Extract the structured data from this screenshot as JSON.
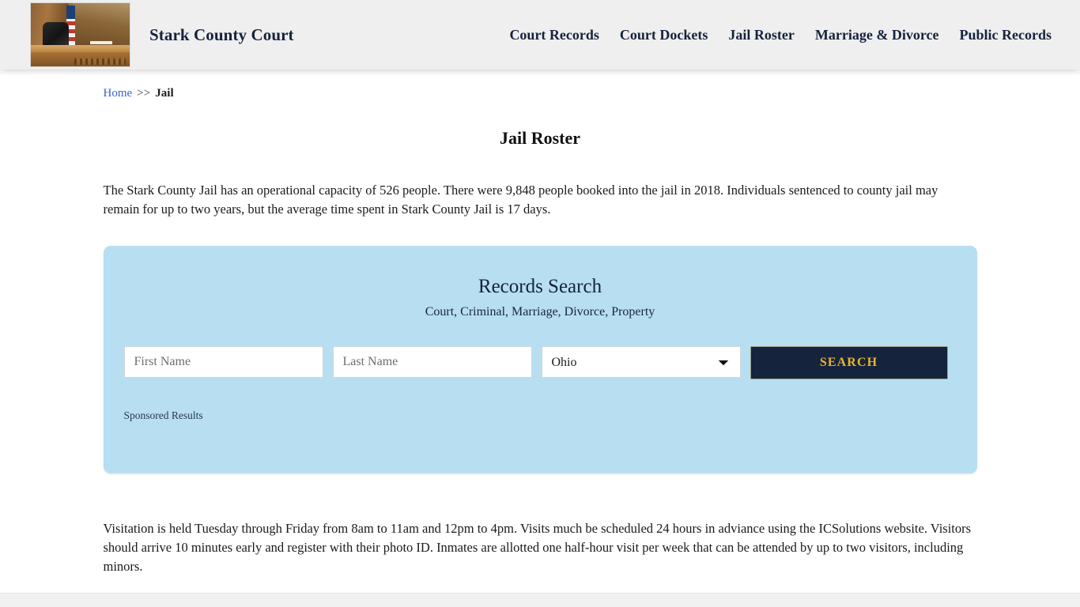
{
  "header": {
    "brand_title": "Stark County Court",
    "logo_alt": "courtroom-photo",
    "nav": [
      {
        "label": "Court Records"
      },
      {
        "label": "Court Dockets"
      },
      {
        "label": "Jail Roster"
      },
      {
        "label": "Marriage & Divorce"
      },
      {
        "label": "Public Records"
      }
    ]
  },
  "breadcrumb": {
    "home_label": "Home",
    "separator": ">>",
    "current_label": "Jail"
  },
  "main": {
    "page_title": "Jail Roster",
    "intro_paragraph": "The Stark County Jail has an operational capacity of 526 people. There were 9,848 people booked into the jail in 2018. Individuals sentenced to county jail may remain for up to two years, but the average time spent in Stark County Jail is 17 days.",
    "visitation_paragraph": "Visitation is held Tuesday through Friday from 8am to 11am and 12pm to 4pm. Visits much be scheduled 24 hours in adviance using the ICSolutions website. Visitors should arrive 10 minutes early and register with their photo ID. Inmates are allotted one half-hour visit per week that can be attended by up to two visitors, including minors."
  },
  "search_panel": {
    "heading": "Records Search",
    "subheading": "Court, Criminal, Marriage, Divorce, Property",
    "first_name_placeholder": "First Name",
    "first_name_value": "",
    "last_name_placeholder": "Last Name",
    "last_name_value": "",
    "state_selected": "Ohio",
    "state_options": [
      "Ohio"
    ],
    "search_button_label": "SEARCH",
    "sponsored_label": "Sponsored Results",
    "panel_color": "#b8def2",
    "button_bg_color": "#16233d",
    "button_text_color": "#e8b62c"
  }
}
